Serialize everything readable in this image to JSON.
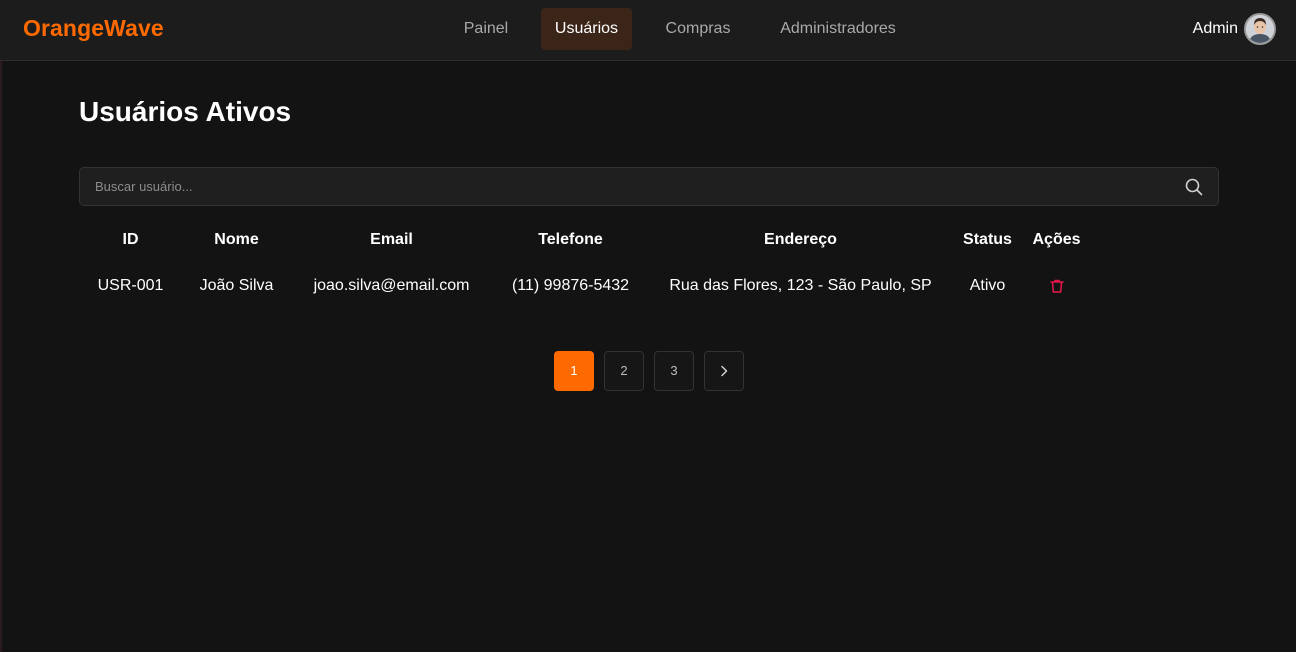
{
  "brand": {
    "name": "OrangeWave",
    "color": "#ff6a00"
  },
  "nav": {
    "items": [
      {
        "label": "Painel",
        "active": false
      },
      {
        "label": "Usuários",
        "active": true
      },
      {
        "label": "Compras",
        "active": false
      },
      {
        "label": "Administradores",
        "active": false
      }
    ]
  },
  "user": {
    "name": "Admin",
    "avatar_icon": "avatar-photo"
  },
  "main": {
    "title": "Usuários Ativos",
    "search": {
      "placeholder": "Buscar usuário...",
      "value": "",
      "icon": "search-icon"
    },
    "table": {
      "headers": [
        "ID",
        "Nome",
        "Email",
        "Telefone",
        "Endereço",
        "Status",
        "Ações"
      ],
      "rows": [
        {
          "id": "USR-001",
          "nome": "João Silva",
          "email": "joao.silva@email.com",
          "telefone": "(11) 99876-5432",
          "endereco": "Rua das Flores, 123 - São Paulo, SP",
          "status": "Ativo",
          "action_icon": "trash-icon"
        }
      ]
    },
    "pagination": {
      "pages": [
        "1",
        "2",
        "3"
      ],
      "current": "1",
      "next_icon": "chevron-right-icon"
    }
  },
  "colors": {
    "accent": "#ff6a00",
    "background": "#131313",
    "navbar": "#1c1c1c",
    "active_tab": "#3b2519",
    "delete": "#e8174a"
  }
}
